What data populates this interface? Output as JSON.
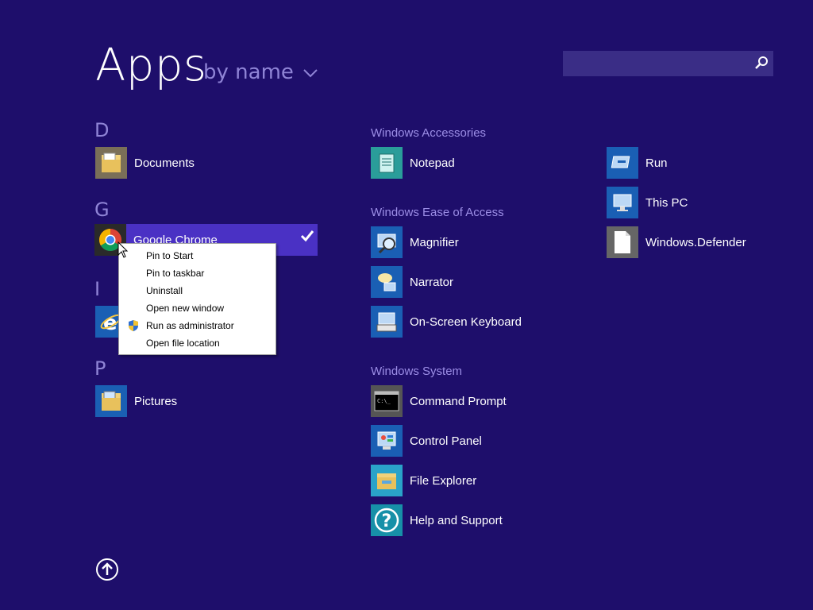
{
  "header": {
    "title": "Apps",
    "sort_label": "by name"
  },
  "search": {
    "value": "",
    "placeholder": ""
  },
  "groups": {
    "d": {
      "letter": "D"
    },
    "g": {
      "letter": "G"
    },
    "i": {
      "letter": "I"
    },
    "p": {
      "letter": "P"
    },
    "accessories": {
      "title": "Windows Accessories"
    },
    "ease": {
      "title": "Windows Ease of Access"
    },
    "system": {
      "title": "Windows System"
    }
  },
  "apps": {
    "documents": "Documents",
    "chrome": "Google Chrome",
    "pictures": "Pictures",
    "notepad": "Notepad",
    "magnifier": "Magnifier",
    "narrator": "Narrator",
    "osk": "On-Screen Keyboard",
    "cmd": "Command Prompt",
    "control_panel": "Control Panel",
    "file_explorer": "File Explorer",
    "help": "Help and Support",
    "run": "Run",
    "this_pc": "This PC",
    "defender": "Windows.Defender"
  },
  "context_menu": {
    "items": [
      {
        "label": "Pin to Start"
      },
      {
        "label": "Pin to taskbar"
      },
      {
        "label": "Uninstall"
      },
      {
        "label": "Open new window"
      },
      {
        "label": "Run as administrator"
      },
      {
        "label": "Open file location"
      }
    ]
  },
  "colors": {
    "background": "#1e0e6b",
    "selection": "#4a31c4",
    "group_header": "#9c8ee6",
    "tile_blue": "#1a5fb4"
  }
}
